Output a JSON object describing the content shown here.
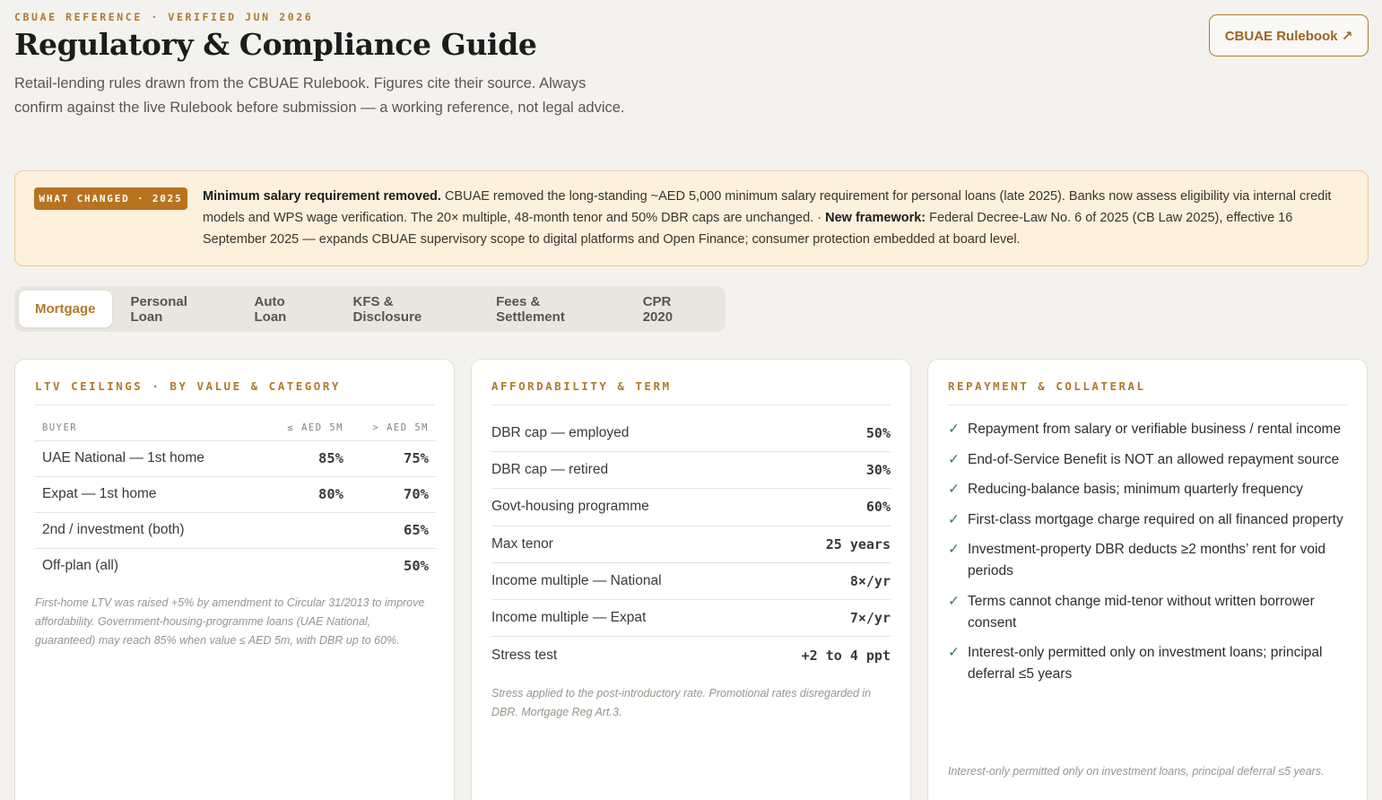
{
  "header": {
    "eyebrow": "CBUAE REFERENCE · VERIFIED JUN 2026",
    "title": "Regulatory & Compliance Guide",
    "subtitle": "Retail-lending rules drawn from the CBUAE Rulebook. Figures cite their source. Always confirm against the live Rulebook before submission — a working reference, not legal advice.",
    "rulebook_button": "CBUAE Rulebook ↗"
  },
  "banner": {
    "badge": "WHAT CHANGED · 2025",
    "lead1": "Minimum salary requirement removed.",
    "text1": " CBUAE removed the long-standing ~AED 5,000 minimum salary requirement for personal loans (late 2025). Banks now assess eligibility via internal credit models and WPS wage verification. The 20× multiple, 48-month tenor and 50% DBR caps are unchanged.",
    "separator": " · ",
    "lead2": "New framework:",
    "text2": " Federal Decree-Law No. 6 of 2025 (CB Law 2025), effective 16 September 2025 — expands CBUAE supervisory scope to digital platforms and Open Finance; consumer protection embedded at board level."
  },
  "tabs": [
    "Mortgage",
    "Personal Loan",
    "Auto Loan",
    "KFS & Disclosure",
    "Fees & Settlement",
    "CPR 2020"
  ],
  "ltv": {
    "title": "LTV CEILINGS · BY VALUE & CATEGORY",
    "headers": [
      "BUYER",
      "≤ AED 5M",
      "> AED 5M"
    ],
    "rows": [
      [
        "UAE National — 1st home",
        "85%",
        "75%"
      ],
      [
        "Expat — 1st home",
        "80%",
        "70%"
      ],
      [
        "2nd / investment (both)",
        "",
        "65%"
      ],
      [
        "Off-plan (all)",
        "",
        "50%"
      ]
    ],
    "note": "First-home LTV was raised +5% by amendment to Circular 31/2013 to improve affordability. Government-housing-programme loans (UAE National, guaranteed) may reach 85% when value ≤ AED 5m, with DBR up to 60%."
  },
  "affordability": {
    "title": "AFFORDABILITY & TERM",
    "rows": [
      [
        "DBR cap — employed",
        "50%"
      ],
      [
        "DBR cap — retired",
        "30%"
      ],
      [
        "Govt-housing programme",
        "60%"
      ],
      [
        "Max tenor",
        "25 years"
      ],
      [
        "Income multiple — National",
        "8×/yr"
      ],
      [
        "Income multiple — Expat",
        "7×/yr"
      ],
      [
        "Stress test",
        "+2 to 4 ppt"
      ]
    ],
    "note": "Stress applied to the post-introductory rate. Promotional rates disregarded in DBR. Mortgage Reg Art.3."
  },
  "repayment": {
    "title": "REPAYMENT & COLLATERAL",
    "check_glyph": "✓",
    "items": [
      "Repayment from salary or verifiable business / rental income",
      "End-of-Service Benefit is NOT an allowed repayment source",
      "Reducing-balance basis; minimum quarterly frequency",
      "First-class mortgage charge required on all financed property",
      "Investment-property DBR deducts ≥2 months’ rent for void periods",
      "Terms cannot change mid-tenor without written borrower consent",
      "Interest-only permitted only on investment loans; principal deferral ≤5 years"
    ],
    "note": "Interest-only permitted only on investment loans, principal deferral ≤5 years."
  },
  "colors": {
    "accent": "#b07a2c",
    "banner_bg": "#fdf0dc",
    "check": "#3f7d55",
    "page_bg": "#f4f2ee"
  }
}
